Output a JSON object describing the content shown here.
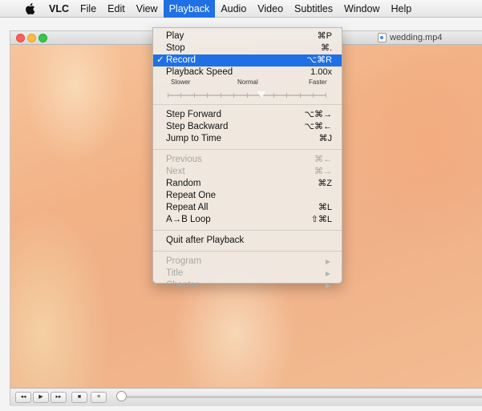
{
  "menubar": {
    "app": "VLC",
    "items": [
      "File",
      "Edit",
      "View",
      "Playback",
      "Audio",
      "Video",
      "Subtitles",
      "Window",
      "Help"
    ],
    "active": "Playback"
  },
  "window": {
    "title": "wedding.mp4"
  },
  "playback_menu": {
    "play": {
      "label": "Play",
      "shortcut": "⌘P"
    },
    "stop": {
      "label": "Stop",
      "shortcut": "⌘."
    },
    "record": {
      "label": "Record",
      "shortcut": "⌥⌘R",
      "checked": true
    },
    "speed": {
      "label": "Playback Speed",
      "value": "1.00x",
      "slower": "Slower",
      "normal": "Normal",
      "faster": "Faster"
    },
    "step_forward": {
      "label": "Step Forward",
      "shortcut": "⌥⌘→"
    },
    "step_backward": {
      "label": "Step Backward",
      "shortcut": "⌥⌘←"
    },
    "jump_to_time": {
      "label": "Jump to Time",
      "shortcut": "⌘J"
    },
    "previous": {
      "label": "Previous",
      "shortcut": "⌘←"
    },
    "next": {
      "label": "Next",
      "shortcut": "⌘→"
    },
    "random": {
      "label": "Random",
      "shortcut": "⌘Z"
    },
    "repeat_one": {
      "label": "Repeat One",
      "shortcut": ""
    },
    "repeat_all": {
      "label": "Repeat All",
      "shortcut": "⌘L"
    },
    "ab_loop": {
      "label": "A→B Loop",
      "shortcut": "⇧⌘L"
    },
    "quit_after": {
      "label": "Quit after Playback"
    },
    "program": {
      "label": "Program"
    },
    "title": {
      "label": "Title"
    },
    "chapter": {
      "label": "Chapter"
    }
  },
  "controls": {
    "rewind": "◂◂",
    "play": "▶",
    "fast_forward": "▸▸",
    "stop": "■",
    "playlist": "≡"
  },
  "colors": {
    "accent": "#1f70e4"
  }
}
